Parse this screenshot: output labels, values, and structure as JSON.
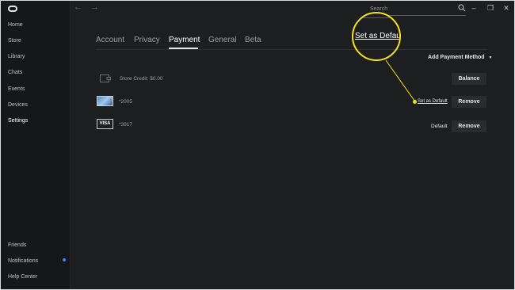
{
  "sidebar": {
    "items": [
      {
        "label": "Home"
      },
      {
        "label": "Store"
      },
      {
        "label": "Library"
      },
      {
        "label": "Chats"
      },
      {
        "label": "Events"
      },
      {
        "label": "Devices"
      },
      {
        "label": "Settings",
        "active": true
      }
    ],
    "bottom_items": [
      {
        "label": "Friends"
      },
      {
        "label": "Notifications",
        "has_notification": true
      },
      {
        "label": "Help Center"
      }
    ]
  },
  "topbar": {
    "search_text": "Search",
    "back_icon": "back-arrow-icon",
    "forward_icon": "forward-arrow-icon",
    "window_controls": [
      "minimize-icon",
      "restore-icon",
      "close-icon"
    ]
  },
  "tabs": [
    {
      "label": "Account"
    },
    {
      "label": "Privacy"
    },
    {
      "label": "Payment",
      "active": true
    },
    {
      "label": "General"
    },
    {
      "label": "Beta"
    }
  ],
  "payment": {
    "add_method_label": "Add Payment Method",
    "store_credit": {
      "label": "Store Credit: $0.00",
      "button": "Balance"
    },
    "cards": [
      {
        "number": "*2005",
        "type": "card-image",
        "action_link": "Set as Default",
        "button": "Remove"
      },
      {
        "number": "*3917",
        "type": "VISA",
        "status": "Default",
        "button": "Remove"
      }
    ]
  },
  "callout": {
    "text": "Set as Default",
    "color": "#f5e21a"
  },
  "colors": {
    "accent": "#3f82f7",
    "highlight": "#f5e21a",
    "background": "#1d1e20",
    "sidebar": "#161719"
  }
}
